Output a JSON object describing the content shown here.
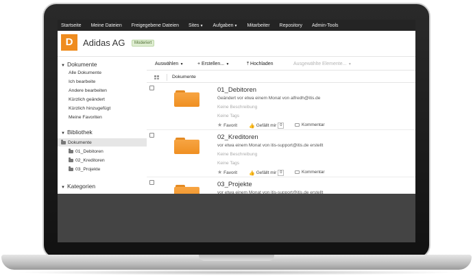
{
  "topnav": {
    "items": [
      "Startseite",
      "Meine Dateien",
      "Freigegebene Dateien",
      "Sites",
      "Aufgaben",
      "Mitarbeiter",
      "Repository",
      "Admin-Tools"
    ]
  },
  "site": {
    "logo_letter": "D",
    "title": "Adidas AG",
    "badge": "Moderiert"
  },
  "sidebar": {
    "dokumente": {
      "heading": "Dokumente",
      "links": [
        "Alle Dokumente",
        "Ich bearbeite",
        "Andere bearbeiten",
        "Kürzlich geändert",
        "Kürzlich hinzugefügt",
        "Meine Favoriten"
      ]
    },
    "bibliothek": {
      "heading": "Bibliothek",
      "root": "Dokumente",
      "folders": [
        "01_Debitoren",
        "02_Kreditoren",
        "03_Projekte"
      ]
    },
    "kategorien": {
      "heading": "Kategorien"
    }
  },
  "toolbar": {
    "select": "Auswählen",
    "create": "Erstellen...",
    "upload": "Hochladen",
    "selected_items": "Ausgewählte Elemente..."
  },
  "list_header": {
    "column": "Dokumente"
  },
  "rows": [
    {
      "title": "01_Debitoren",
      "desc": "Geändert vor etwa einem Monat von alfredh@itis.de",
      "no_desc": "Keine Beschreibung",
      "no_tags": "Keine Tags",
      "favorite": "Favorit",
      "like": "Gefällt mir",
      "like_count": "0",
      "comment": "Kommentar"
    },
    {
      "title": "02_Kreditoren",
      "desc": "vor etwa einem Monat von itis-support@itis.de erstellt",
      "no_desc": "Keine Beschreibung",
      "no_tags": "Keine Tags",
      "favorite": "Favorit",
      "like": "Gefällt mir",
      "like_count": "0",
      "comment": "Kommentar"
    },
    {
      "title": "03_Projekte",
      "desc": "vor etwa einem Monat von itis-support@itis.de erstellt"
    }
  ]
}
